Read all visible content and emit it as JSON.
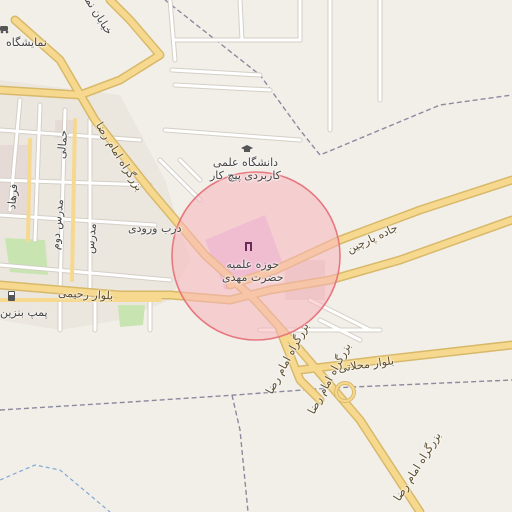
{
  "map": {
    "colors": {
      "land": "#f2efe9",
      "major_road": "#f6d98f",
      "major_road_casing": "#d8b96a",
      "minor_road": "#ffffff",
      "minor_road_casing": "#d4cfc6",
      "boundary": "#8c8a9e",
      "water_line": "#7fa8d8",
      "park": "#c8e4b0",
      "built": "#e8ddd8",
      "highlight_fill": "#f8b4bc",
      "highlight_stroke": "#e7787f",
      "poi_area": "#e6c3e8"
    },
    "highlight_circle": {
      "shown": true
    },
    "labels": {
      "top_left_1": "خیابان نماز",
      "top_left_2": "نمایشگاه",
      "university": "دانشگاه علمی\nکاربردی پیچ کار",
      "hawza": "حوزه علمیه\nحضرت مهدی",
      "entrance": "درب ورودی",
      "jade_parchin": "جاده پارچین",
      "bolvar_rahimi": "بلوار رحیمی",
      "bolvar_mahallati": "بلوار محلاتی",
      "bozorgrah_imam_reza_1": "بزرگراه امام رضا",
      "bozorgrah_imam_reza_2": "بزرگراه امام رضا",
      "bozorgrah_imam_reza_3": "بزرگراه امام رضا",
      "bozorgrah_imam_reza_4": "بزرگراه امام رضا",
      "pomp_benzin": "پمپ بنزین",
      "jamali": "جمالی",
      "modarres_1": "مدرس دوم",
      "modarres_2": "مدرس",
      "fard": "فرهاد"
    },
    "icons": [
      "car-icon",
      "university-icon",
      "religious-site-icon",
      "fuel-icon"
    ]
  }
}
